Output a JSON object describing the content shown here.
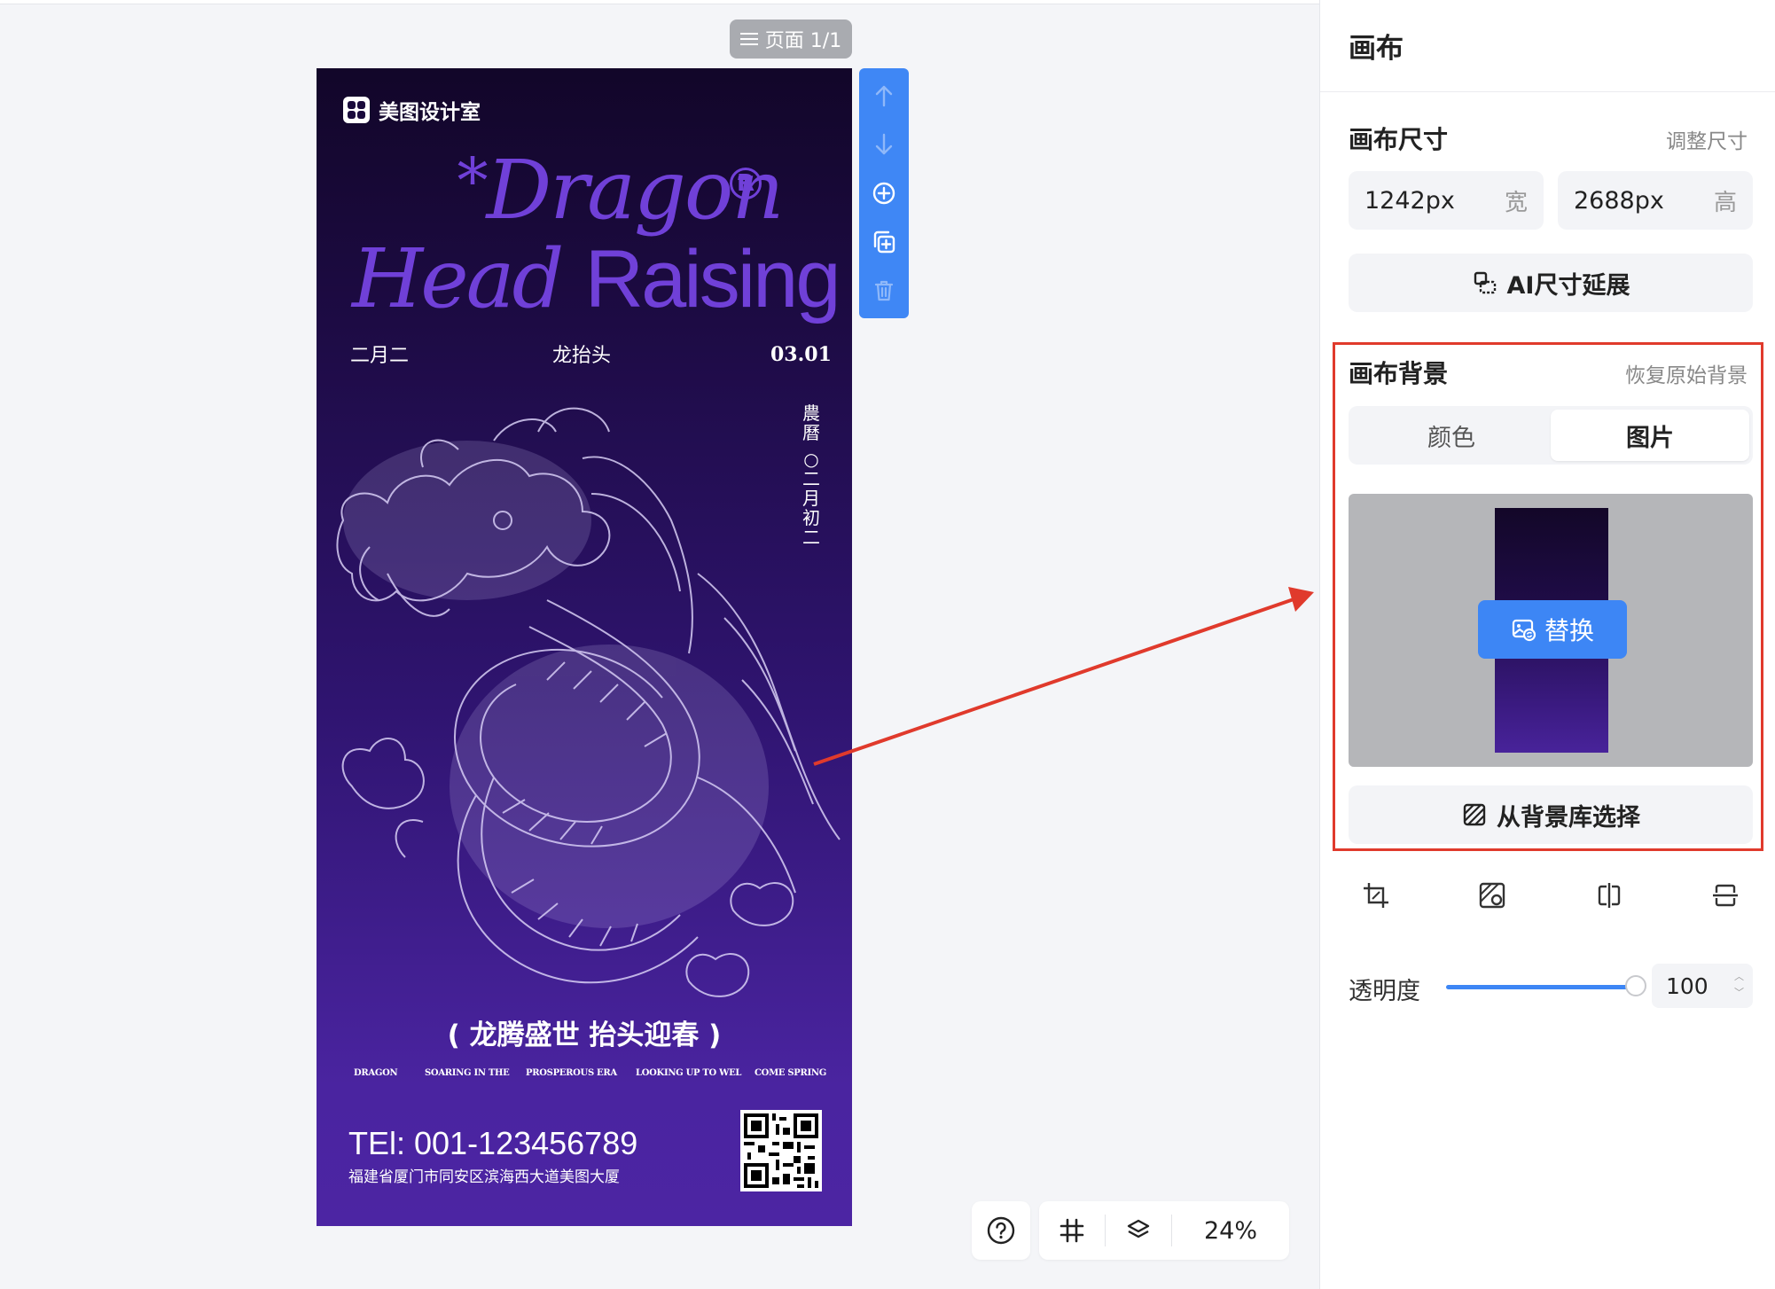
{
  "canvas": {
    "page_indicator": "页面 1/1",
    "poster": {
      "brand": "美图设计室",
      "title_line1": "Dragon",
      "title_star": "*",
      "title_reg": "R",
      "title_line2_a": "Head",
      "title_line2_b": "Raising",
      "date_left": "二月二",
      "date_mid": "龙抬头",
      "date_right": "03.01",
      "vertical_text": [
        "農",
        "曆",
        "○",
        "二",
        "月",
        "初",
        "二"
      ],
      "slogan": "( 龙腾盛世 抬头迎春 )",
      "slogan_en": [
        "DRAGON",
        "SOARING IN THE",
        "PROSPEROUS ERA",
        "LOOKING UP TO WEL",
        "COME SPRING"
      ],
      "tel": "TEl: 001-123456789",
      "address": "福建省厦门市同安区滨海西大道美图大厦"
    },
    "side_toolbar": [
      "arrow-up-icon",
      "arrow-down-icon",
      "add-page-icon",
      "duplicate-page-icon",
      "delete-page-icon"
    ],
    "zoom": "24%"
  },
  "panel": {
    "header": "画布",
    "size_section": {
      "title": "画布尺寸",
      "link": "调整尺寸",
      "width_value": "1242px",
      "width_unit": "宽",
      "height_value": "2688px",
      "height_unit": "高",
      "ai_button": "AI尺寸延展"
    },
    "bg_section": {
      "title": "画布背景",
      "link": "恢复原始背景",
      "tabs": [
        "颜色",
        "图片"
      ],
      "active_tab": "图片",
      "replace_button": "替换",
      "library_button": "从背景库选择"
    },
    "opacity": {
      "label": "透明度",
      "value": "100",
      "level": 1.0
    }
  },
  "colors": {
    "accent": "#3d86f5",
    "annotation": "#e03a2c",
    "poster_title": "#7040d8"
  }
}
